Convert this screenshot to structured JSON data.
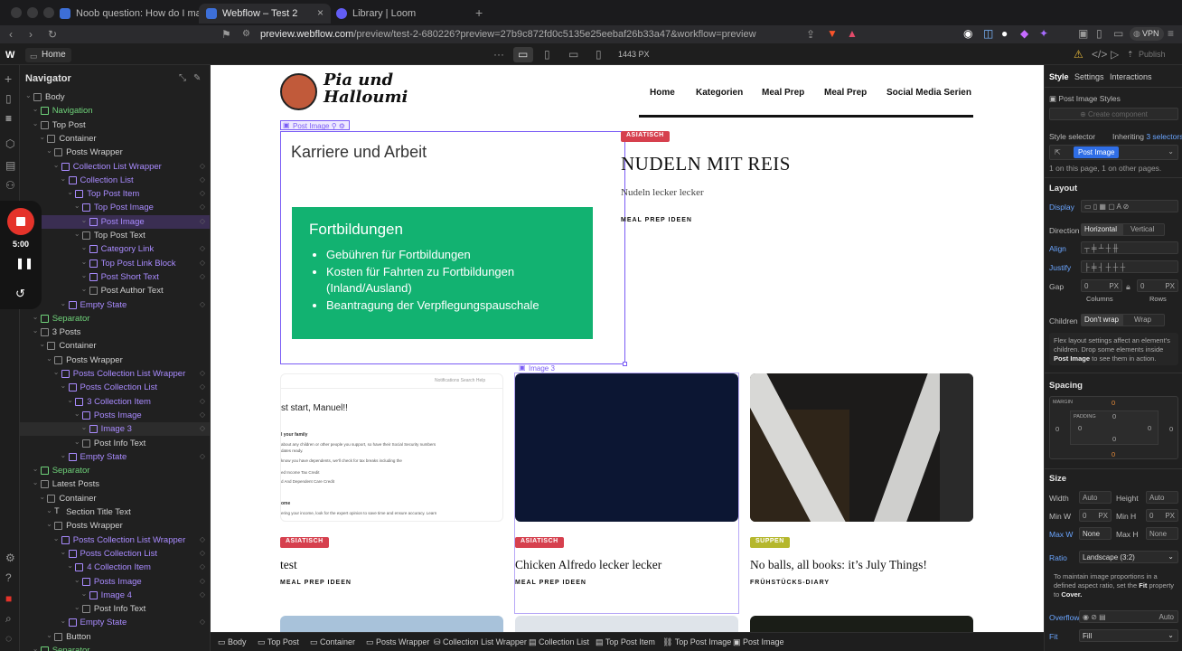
{
  "browser": {
    "tabs": [
      {
        "label": "Noob question: How do I make the ...",
        "active": false
      },
      {
        "label": "Webflow – Test 2",
        "active": true
      },
      {
        "label": "Library | Loom",
        "active": false
      }
    ],
    "url_host": "preview.webflow.com",
    "url_rest": "/preview/test-2-680226?preview=27b9c872fd0c5135e25eebaf26b33a47&workflow=preview",
    "vpn": "VPN"
  },
  "topbar": {
    "page": "Home",
    "width": "1443 PX",
    "publish": "Publish"
  },
  "navigator": {
    "title": "Navigator",
    "rows": [
      {
        "label": "Body",
        "indent": 0,
        "type": "box"
      },
      {
        "label": "Navigation",
        "indent": 1,
        "type": "green"
      },
      {
        "label": "Top Post",
        "indent": 1,
        "type": "box"
      },
      {
        "label": "Container",
        "indent": 2,
        "type": "box"
      },
      {
        "label": "Posts Wrapper",
        "indent": 3,
        "type": "box"
      },
      {
        "label": "Collection List Wrapper",
        "indent": 4,
        "type": "purple"
      },
      {
        "label": "Collection List",
        "indent": 5,
        "type": "purple"
      },
      {
        "label": "Top Post Item",
        "indent": 6,
        "type": "purple"
      },
      {
        "label": "Top Post Image",
        "indent": 7,
        "type": "purple"
      },
      {
        "label": "Post Image",
        "indent": 8,
        "type": "purple",
        "state": "selected"
      },
      {
        "label": "Top Post Text",
        "indent": 7,
        "type": "box"
      },
      {
        "label": "Category Link",
        "indent": 8,
        "type": "purple"
      },
      {
        "label": "Top Post Link Block",
        "indent": 8,
        "type": "purple"
      },
      {
        "label": "Post Short Text",
        "indent": 8,
        "type": "purple"
      },
      {
        "label": "Post Author Text",
        "indent": 8,
        "type": "box"
      },
      {
        "label": "Empty State",
        "indent": 5,
        "type": "purple"
      },
      {
        "label": "Separator",
        "indent": 1,
        "type": "green"
      },
      {
        "label": "3 Posts",
        "indent": 1,
        "type": "box"
      },
      {
        "label": "Container",
        "indent": 2,
        "type": "box"
      },
      {
        "label": "Posts Wrapper",
        "indent": 3,
        "type": "box"
      },
      {
        "label": "Posts Collection List Wrapper",
        "indent": 4,
        "type": "purple"
      },
      {
        "label": "Posts Collection List",
        "indent": 5,
        "type": "purple"
      },
      {
        "label": "3 Collection Item",
        "indent": 6,
        "type": "purple"
      },
      {
        "label": "Posts Image",
        "indent": 7,
        "type": "purple"
      },
      {
        "label": "Image 3",
        "indent": 8,
        "type": "purple",
        "state": "sub"
      },
      {
        "label": "Post Info Text",
        "indent": 7,
        "type": "box"
      },
      {
        "label": "Empty State",
        "indent": 5,
        "type": "purple"
      },
      {
        "label": "Separator",
        "indent": 1,
        "type": "green"
      },
      {
        "label": "Latest Posts",
        "indent": 1,
        "type": "box"
      },
      {
        "label": "Container",
        "indent": 2,
        "type": "box"
      },
      {
        "label": "Section Title Text",
        "indent": 3,
        "type": "text"
      },
      {
        "label": "Posts Wrapper",
        "indent": 3,
        "type": "box"
      },
      {
        "label": "Posts Collection List Wrapper",
        "indent": 4,
        "type": "purple"
      },
      {
        "label": "Posts Collection List",
        "indent": 5,
        "type": "purple"
      },
      {
        "label": "4 Collection Item",
        "indent": 6,
        "type": "purple"
      },
      {
        "label": "Posts Image",
        "indent": 7,
        "type": "purple"
      },
      {
        "label": "Image 4",
        "indent": 8,
        "type": "purple"
      },
      {
        "label": "Post Info Text",
        "indent": 7,
        "type": "box"
      },
      {
        "label": "Empty State",
        "indent": 5,
        "type": "purple"
      },
      {
        "label": "Button",
        "indent": 3,
        "type": "box"
      },
      {
        "label": "Separator",
        "indent": 1,
        "type": "green"
      }
    ]
  },
  "recorder": {
    "time": "5:00"
  },
  "site": {
    "logo": "Pia und\nHalloumi",
    "nav": [
      "Home",
      "Kategorien",
      "Meal Prep",
      "Meal Prep",
      "Social Media Serien"
    ],
    "selected_label": "Post Image",
    "hover_label": "Image 3",
    "top_post": {
      "badge": "ASIATISCH",
      "title": "NUDELN MIT REIS",
      "desc": "Nudeln lecker lecker",
      "meta": "MEAL PREP IDEEN"
    },
    "slide": {
      "heading": "Karriere und Arbeit",
      "box_title": "Fortbildungen",
      "bullets": [
        "Gebühren für Fortbildungen",
        "Kosten für Fahrten zu Fortbildungen (Inland/Ausland)",
        "Beantragung der Verpflegungspauschale"
      ]
    },
    "posts": [
      {
        "badge": "ASIATISCH",
        "title": "test",
        "meta": "MEAL PREP IDEEN"
      },
      {
        "badge": "ASIATISCH",
        "title": "Chicken Alfredo lecker lecker",
        "meta": "MEAL PREP IDEEN"
      },
      {
        "badge": "SUPPEN",
        "title": "No balls, all books: it’s July Things!",
        "meta": "FRÜHSTÜCKS-DIARY"
      }
    ],
    "screenshot_card": {
      "greeting": "st start, Manuel!!",
      "nav": "Notifications   Search   Help",
      "l1": "l your family",
      "l2": "about any children or other people you support, so have their Social Security numbers",
      "l3": "dates ready.",
      "l4": "know you have dependents, we'll check for tax breaks including the",
      "l5": "ed Income Tax Credit",
      "l6": "d And Dependent Care Credit",
      "l7": "ome",
      "l8": "ering your income, look for the expert opinion to save time and ensure accuracy. Learn"
    }
  },
  "breadcrumbs": [
    "Body",
    "Top Post",
    "Container",
    "Posts Wrapper",
    "Collection List Wrapper",
    "Collection List",
    "Top Post Item",
    "Top Post Image",
    "Post Image"
  ],
  "panel": {
    "tabs": [
      "Style",
      "Settings",
      "Interactions"
    ],
    "element": "Post Image Styles",
    "create": "Create component",
    "selector_label": "Style selector",
    "inheriting": "Inheriting",
    "inheriting_n": "3 selectors",
    "selector": "Post Image",
    "selector_info": "1 on this page, 1 on other pages.",
    "layout": "Layout",
    "display": "Display",
    "direction": "Direction",
    "horizontal": "Horizontal",
    "vertical": "Vertical",
    "align": "Align",
    "justify": "Justify",
    "gap": "Gap",
    "gap_v1": "0",
    "gap_v2": "0",
    "px": "PX",
    "columns": "Columns",
    "rows": "Rows",
    "children": "Children",
    "dont_wrap": "Don't wrap",
    "wrap": "Wrap",
    "flex_note": "Flex layout settings affect an element's children. Drop some elements inside",
    "flex_note_b": "Post Image",
    "flex_note_c": "to see them in action.",
    "spacing": "Spacing",
    "margin": "MARGIN",
    "padding": "PADDING",
    "zero": "0",
    "size": "Size",
    "width": "Width",
    "height": "Height",
    "auto": "Auto",
    "minw": "Min W",
    "minh": "Min H",
    "maxw": "Max W",
    "maxh": "Max H",
    "none": "None",
    "ratio": "Ratio",
    "ratio_val": "Landscape (3:2)",
    "ratio_note": "To maintain image proportions in a defined aspect ratio, set the",
    "ratio_note_b": "Fit",
    "ratio_note_c": "property to",
    "ratio_note_d": "Cover.",
    "overflow": "Overflow",
    "fit": "Fit",
    "fit_val": "Fill"
  },
  "colors": {
    "purple": "#7a5cf5",
    "green": "#12b271",
    "red_badge": "#d6404e",
    "olive_badge": "#b5b72c",
    "navy": "#0c1633"
  }
}
